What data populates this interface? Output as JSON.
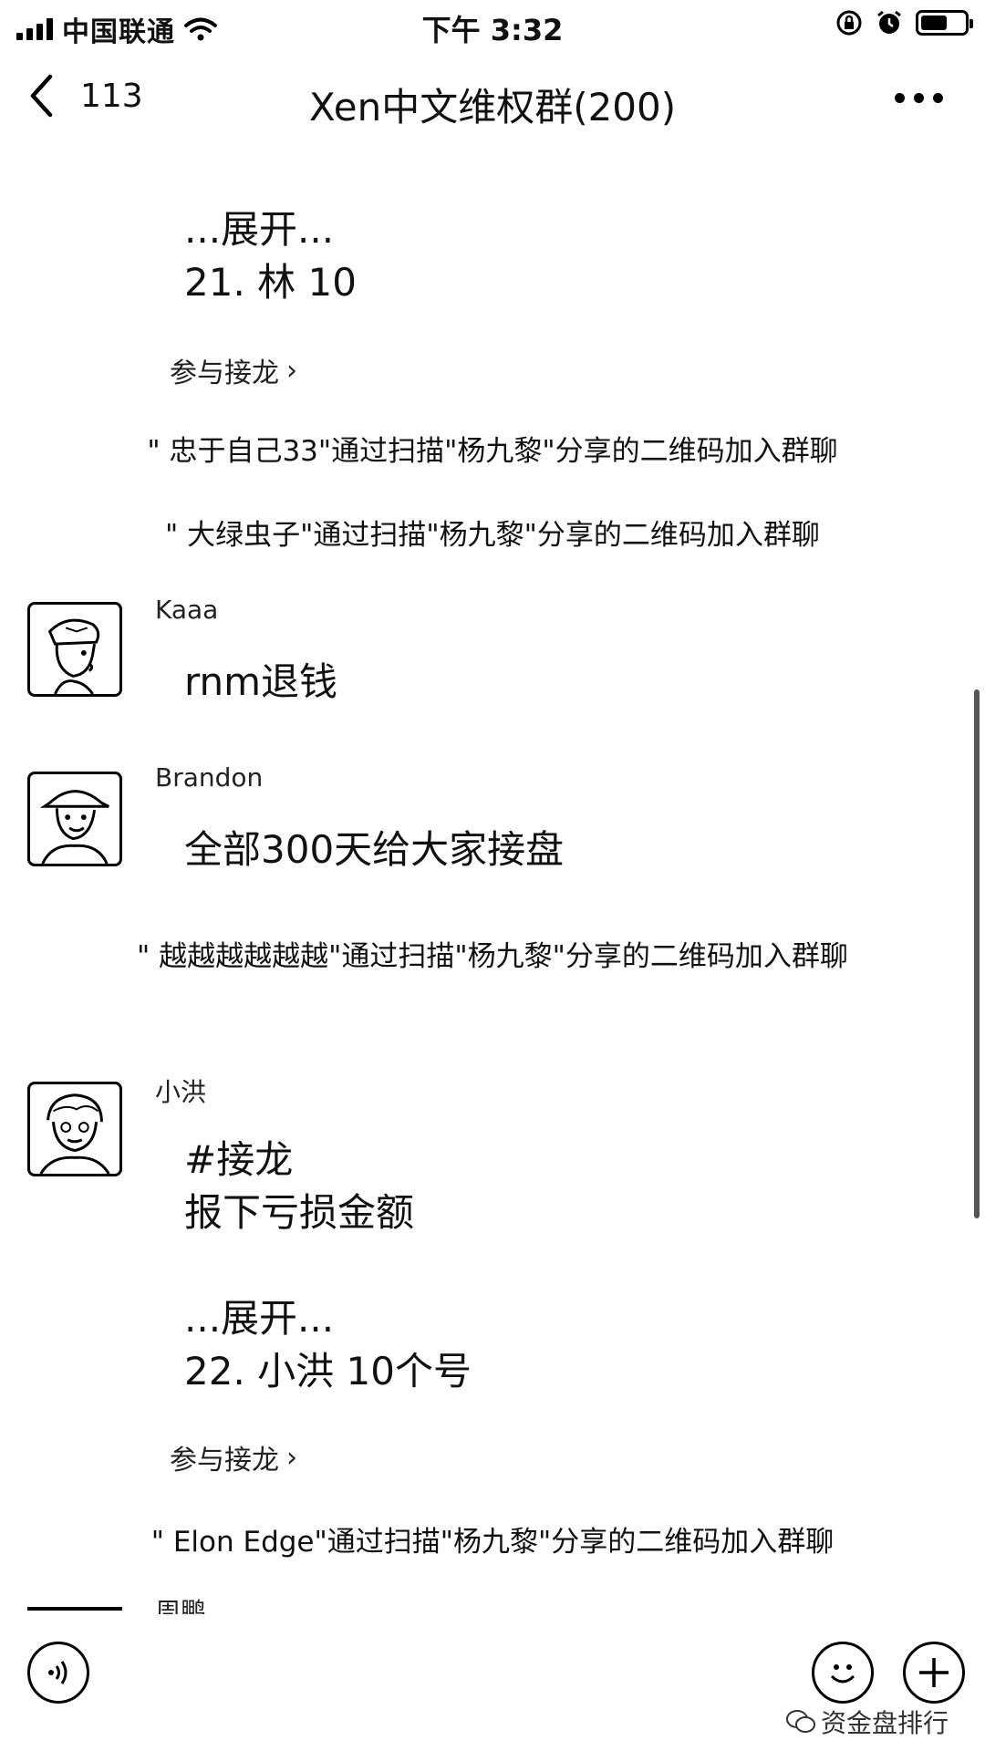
{
  "status_bar": {
    "carrier": "中国联通",
    "time": "下午 3:32",
    "battery_level": 0.6
  },
  "nav": {
    "back_count": "113",
    "title": "Xen中文维权群(200)"
  },
  "chat": {
    "jielong_1": {
      "expand": "...展开...",
      "entry": "21. 林 10",
      "join_label": "参与接龙"
    },
    "system_messages": [
      "\" 忠于自己33\"通过扫描\"杨九黎\"分享的二维码加入群聊",
      "\" 大绿虫子\"通过扫描\"杨九黎\"分享的二维码加入群聊",
      "\" 越越越越越越\"通过扫描\"杨九黎\"分享的二维码加入群聊",
      "\" Elon Edge\"通过扫描\"杨九黎\"分享的二维码加入群聊"
    ],
    "messages": [
      {
        "sender": "Kaaa",
        "text": "rnm退钱"
      },
      {
        "sender": "Brandon",
        "text": "全部300天给大家接盘"
      },
      {
        "sender": "小洪",
        "line1": "#接龙",
        "line2": "报下亏损金额",
        "expand": "...展开...",
        "entry": "22. 小洪  10个号",
        "join_label": "参与接龙"
      }
    ],
    "partial_sender": "周鹏"
  },
  "watermark": "资金盘排行",
  "icons": {
    "voice": "voice-icon",
    "emoji": "emoji-icon",
    "plus": "plus-icon",
    "back": "chevron-left-icon",
    "more": "more-dots-icon"
  }
}
